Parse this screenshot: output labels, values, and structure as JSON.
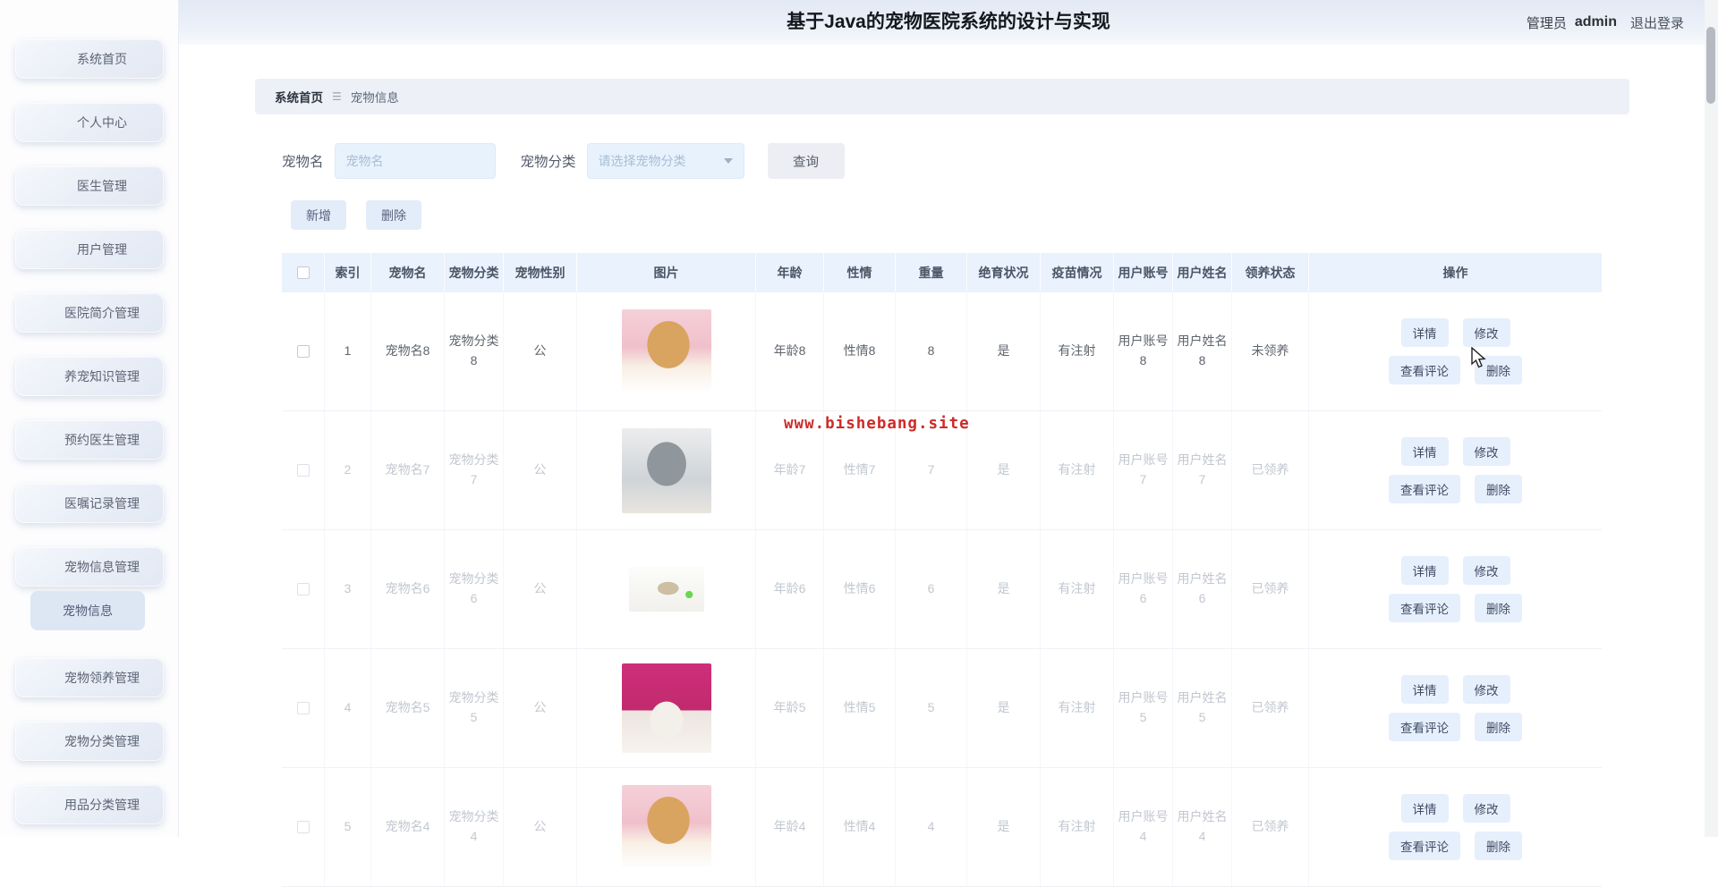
{
  "header": {
    "title": "基于Java的宠物医院系统的设计与实现",
    "user_role": "管理员",
    "username": "admin",
    "logout_label": "退出登录"
  },
  "sidebar": {
    "items": [
      {
        "label": "系统首页"
      },
      {
        "label": "个人中心"
      },
      {
        "label": "医生管理"
      },
      {
        "label": "用户管理"
      },
      {
        "label": "医院简介管理"
      },
      {
        "label": "养宠知识管理"
      },
      {
        "label": "预约医生管理"
      },
      {
        "label": "医嘱记录管理"
      },
      {
        "label": "宠物信息管理",
        "children": [
          {
            "label": "宠物信息",
            "active": true
          }
        ]
      },
      {
        "label": "宠物领养管理"
      },
      {
        "label": "宠物分类管理"
      },
      {
        "label": "用品分类管理"
      }
    ]
  },
  "breadcrumb": {
    "root": "系统首页",
    "separator_icon": "☰",
    "current": "宠物信息"
  },
  "search": {
    "name_label": "宠物名",
    "name_placeholder": "宠物名",
    "name_value": "",
    "category_label": "宠物分类",
    "category_placeholder": "请选择宠物分类",
    "query_label": "查询"
  },
  "toolbar": {
    "add_label": "新增",
    "delete_label": "删除"
  },
  "table": {
    "columns": [
      "索引",
      "宠物名",
      "宠物分类",
      "宠物性别",
      "图片",
      "年龄",
      "性情",
      "重量",
      "绝育状况",
      "疫苗情况",
      "用户账号",
      "用户姓名",
      "领养状态",
      "操作"
    ],
    "action_labels": {
      "detail": "详情",
      "edit": "修改",
      "comments": "查看评论",
      "delete": "删除"
    },
    "rows": [
      {
        "index": "1",
        "name": "宠物名8",
        "category": "宠物分类8",
        "gender": "公",
        "image": "golden-puppy-on-pink-blanket",
        "age": "年龄8",
        "temperament": "性情8",
        "weight": "8",
        "neutered": "是",
        "vaccine": "有注射",
        "account": "用户账号8",
        "user_name": "用户姓名8",
        "adoption": "未领养",
        "muted": false
      },
      {
        "index": "2",
        "name": "宠物名7",
        "category": "宠物分类7",
        "gender": "公",
        "image": "gray-kitten",
        "age": "年龄7",
        "temperament": "性情7",
        "weight": "7",
        "neutered": "是",
        "vaccine": "有注射",
        "account": "用户账号7",
        "user_name": "用户姓名7",
        "adoption": "已领养",
        "muted": true
      },
      {
        "index": "3",
        "name": "宠物名6",
        "category": "宠物分类6",
        "gender": "公",
        "image": "rabbit-with-cart",
        "age": "年龄6",
        "temperament": "性情6",
        "weight": "6",
        "neutered": "是",
        "vaccine": "有注射",
        "account": "用户账号6",
        "user_name": "用户姓名6",
        "adoption": "已领养",
        "muted": true
      },
      {
        "index": "4",
        "name": "宠物名5",
        "category": "宠物分类5",
        "gender": "公",
        "image": "white-poodle-on-magenta",
        "age": "年龄5",
        "temperament": "性情5",
        "weight": "5",
        "neutered": "是",
        "vaccine": "有注射",
        "account": "用户账号5",
        "user_name": "用户姓名5",
        "adoption": "已领养",
        "muted": true
      },
      {
        "index": "5",
        "name": "宠物名4",
        "category": "宠物分类4",
        "gender": "公",
        "image": "golden-puppy-on-pink",
        "age": "年龄4",
        "temperament": "性情4",
        "weight": "4",
        "neutered": "是",
        "vaccine": "有注射",
        "account": "用户账号4",
        "user_name": "用户姓名4",
        "adoption": "已领养",
        "muted": true
      }
    ]
  },
  "watermark": {
    "text": "www.bishebang.site",
    "color": "#cd2b28"
  },
  "colors": {
    "table_header_bg": "#e9f2fd",
    "action_button_bg": "#e6effc",
    "input_bg": "#e7f2fd",
    "sidebar_pill_bg": "#e8edf6",
    "topbar_bg": "#e2e9f5",
    "primary_text": "#5f656d",
    "muted_text": "#c2c7cf"
  }
}
